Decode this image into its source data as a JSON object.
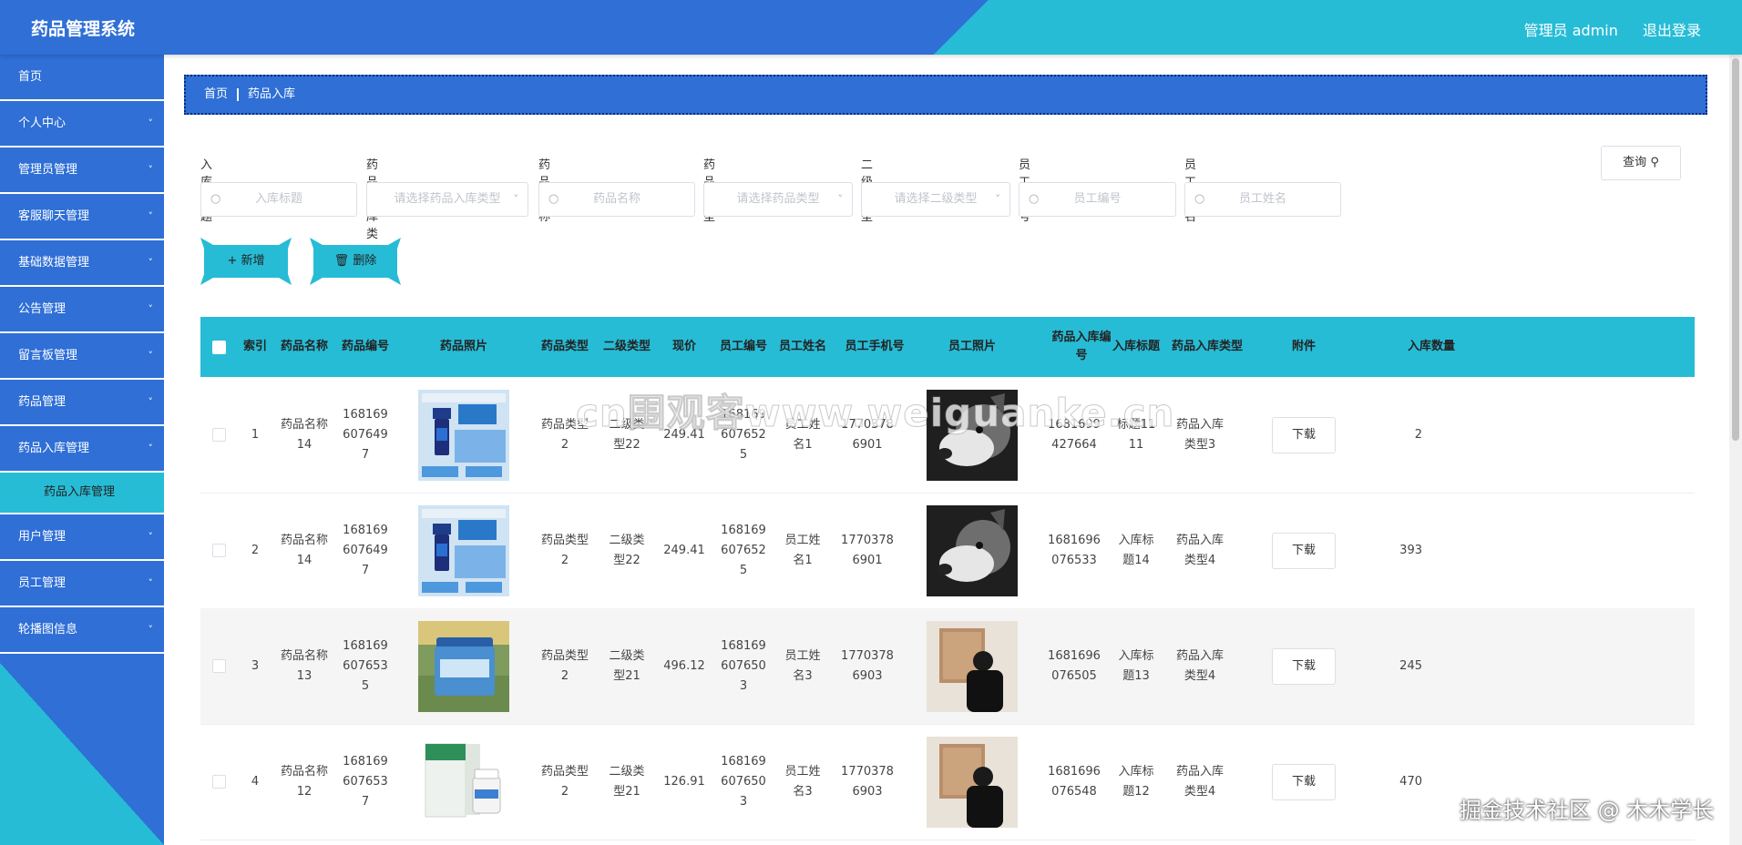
{
  "app": {
    "title": "药品管理系统",
    "user_label": "管理员 admin",
    "logout": "退出登录"
  },
  "colors": {
    "primary": "#2f6fd6",
    "accent": "#27bcd6"
  },
  "sidebar": {
    "items": [
      {
        "label": "首页"
      },
      {
        "label": "个人中心"
      },
      {
        "label": "管理员管理"
      },
      {
        "label": "客服聊天管理"
      },
      {
        "label": "基础数据管理"
      },
      {
        "label": "公告管理"
      },
      {
        "label": "留言板管理"
      },
      {
        "label": "药品管理"
      },
      {
        "label": "药品入库管理"
      },
      {
        "label": "用户管理"
      },
      {
        "label": "员工管理"
      },
      {
        "label": "轮播图信息"
      }
    ],
    "sub_item": "药品入库管理"
  },
  "breadcrumb": {
    "home": "首页",
    "current": "药品入库"
  },
  "filters": [
    {
      "label": "入库标题",
      "placeholder": "入库标题",
      "type": "search"
    },
    {
      "label": "药品入库类型",
      "placeholder": "请选择药品入库类型",
      "type": "select"
    },
    {
      "label": "药品名称",
      "placeholder": "药品名称",
      "type": "search"
    },
    {
      "label": "药品类型",
      "placeholder": "请选择药品类型",
      "type": "select"
    },
    {
      "label": "二级类型",
      "placeholder": "请选择二级类型",
      "type": "select"
    },
    {
      "label": "员工编号",
      "placeholder": "员工编号",
      "type": "search"
    },
    {
      "label": "员工姓名",
      "placeholder": "员工姓名",
      "type": "search"
    }
  ],
  "buttons": {
    "query": "查询",
    "add": "新增",
    "delete": "删除",
    "download": "下载"
  },
  "table": {
    "headers": [
      "索引",
      "药品名称",
      "药品编号",
      "药品照片",
      "药品类型",
      "二级类型",
      "现价",
      "员工编号",
      "员工姓名",
      "员工手机号",
      "员工照片",
      "药品入库编号",
      "入库标题",
      "药品入库类型",
      "附件",
      "入库数量"
    ],
    "rows": [
      {
        "index": "1",
        "name": "药品名称14",
        "code": "1681696076497",
        "type": "药品类型2",
        "sub_type": "二级类型22",
        "price": "249.41",
        "emp_no": "1681696076525",
        "emp_name": "员工姓名1",
        "phone": "17703786901",
        "stock_no": "1681699427664",
        "stock_title": "标题1111",
        "stock_type": "药品入库类型3",
        "qty": "2",
        "photo": "blue",
        "emp_photo": "husky"
      },
      {
        "index": "2",
        "name": "药品名称14",
        "code": "1681696076497",
        "type": "药品类型2",
        "sub_type": "二级类型22",
        "price": "249.41",
        "emp_no": "1681696076525",
        "emp_name": "员工姓名1",
        "phone": "17703786901",
        "stock_no": "1681696076533",
        "stock_title": "入库标题14",
        "stock_type": "药品入库类型4",
        "qty": "393",
        "photo": "blue",
        "emp_photo": "husky"
      },
      {
        "index": "3",
        "name": "药品名称13",
        "code": "1681696076535",
        "type": "药品类型2",
        "sub_type": "二级类型21",
        "price": "496.12",
        "emp_no": "1681696076503",
        "emp_name": "员工姓名3",
        "phone": "17703786903",
        "stock_no": "1681696076505",
        "stock_title": "入库标题13",
        "stock_type": "药品入库类型4",
        "qty": "245",
        "photo": "jar",
        "emp_photo": "person"
      },
      {
        "index": "4",
        "name": "药品名称12",
        "code": "1681696076537",
        "type": "药品类型2",
        "sub_type": "二级类型21",
        "price": "126.91",
        "emp_no": "1681696076503",
        "emp_name": "员工姓名3",
        "phone": "17703786903",
        "stock_no": "1681696076548",
        "stock_title": "入库标题12",
        "stock_type": "药品入库类型4",
        "qty": "470",
        "photo": "box",
        "emp_photo": "person"
      }
    ]
  },
  "watermarks": {
    "center": "cn围观客www.weiguanke.cn",
    "corner": "掘金技术社区 @ 木木学长"
  }
}
